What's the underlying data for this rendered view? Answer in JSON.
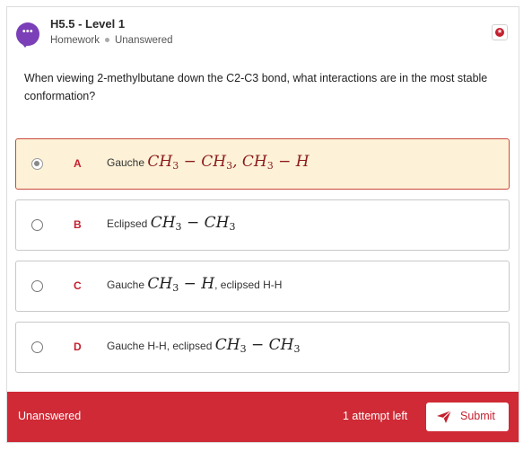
{
  "header": {
    "title": "H5.5 - Level 1",
    "category": "Homework",
    "status": "Unanswered",
    "avatar_icon": "chat-bubble-icon",
    "star_icon": "star-icon"
  },
  "question": {
    "text": "When viewing 2-methylbutane down the C2-C3 bond, what interactions are in the most stable conformation?"
  },
  "options": [
    {
      "letter": "A",
      "selected": true,
      "prefix": "Gauche",
      "math": [
        "CH",
        "3",
        " − CH",
        "3",
        ", CH",
        "3",
        " − H"
      ],
      "suffix": ""
    },
    {
      "letter": "B",
      "selected": false,
      "prefix": "Eclipsed",
      "math": [
        "CH",
        "3",
        " − CH",
        "3"
      ],
      "suffix": ""
    },
    {
      "letter": "C",
      "selected": false,
      "prefix": "Gauche",
      "math": [
        "CH",
        "3",
        " − H"
      ],
      "suffix": ", eclipsed H-H"
    },
    {
      "letter": "D",
      "selected": false,
      "prefix": "Gauche H-H, eclipsed",
      "math": [
        "CH",
        "3",
        " − CH",
        "3"
      ],
      "suffix": ""
    }
  ],
  "footer": {
    "status": "Unanswered",
    "attempts": "1 attempt left",
    "submit_label": "Submit",
    "submit_icon": "paper-plane-icon"
  },
  "colors": {
    "accent_red": "#cf2a35",
    "avatar_purple": "#7b3fb8",
    "selected_bg": "#fdf2d8"
  }
}
